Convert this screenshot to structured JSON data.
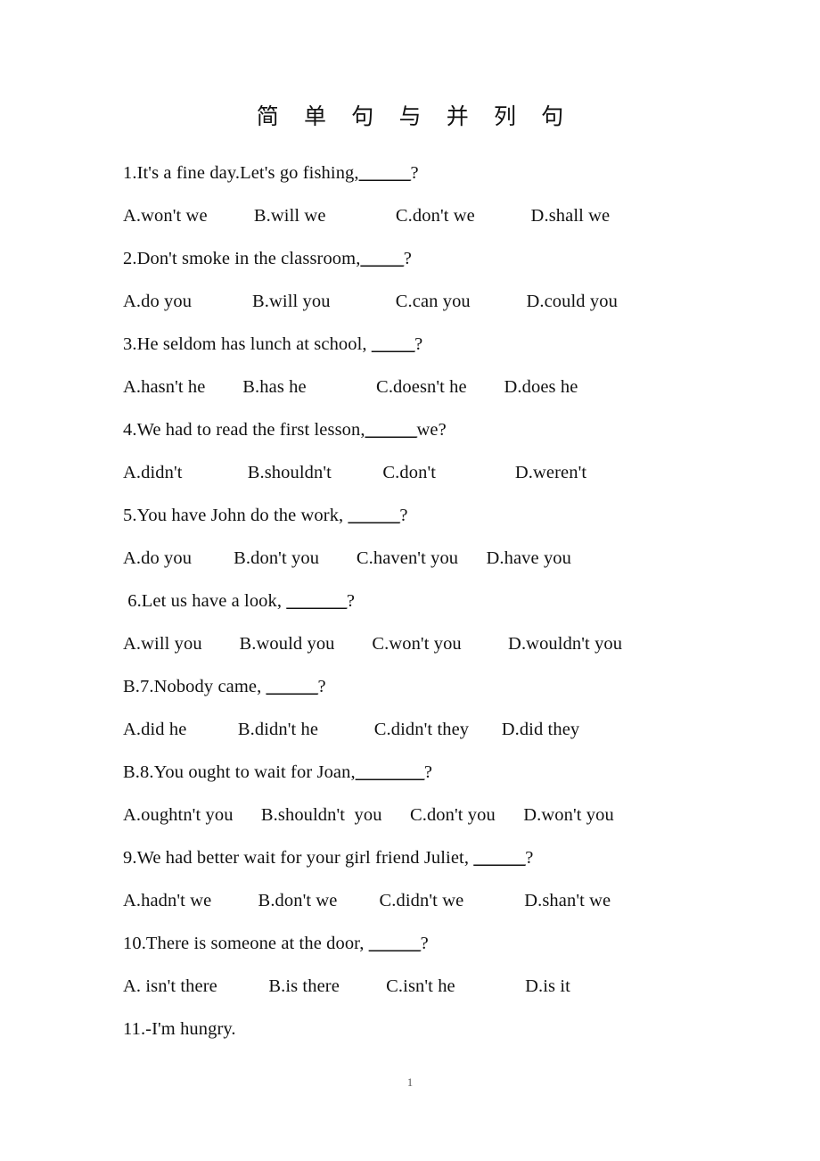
{
  "document": {
    "title": "简 单 句 与 并 列 句",
    "page_number": "1"
  },
  "items": [
    {
      "kind": "question",
      "text": "1.It's a fine day.Let's go fishing,",
      "blank": "______",
      "tail": "?"
    },
    {
      "kind": "options",
      "text": "A.won't we          B.will we               C.don't we            D.shall we"
    },
    {
      "kind": "question",
      "text": "2.Don't smoke in the classroom,",
      "blank": "_____",
      "tail": "?"
    },
    {
      "kind": "options",
      "text": "A.do you             B.will you              C.can you            D.could you"
    },
    {
      "kind": "question",
      "text": "3.He seldom has lunch at school, ",
      "blank": "_____",
      "tail": "?"
    },
    {
      "kind": "options",
      "text": "A.hasn't he        B.has he               C.doesn't he        D.does he"
    },
    {
      "kind": "question",
      "text": "4.We had to read the first lesson,",
      "blank": "______",
      "tail": "we?"
    },
    {
      "kind": "options",
      "text": "A.didn't              B.shouldn't           C.don't                 D.weren't"
    },
    {
      "kind": "question",
      "text": "5.You have John do the work, ",
      "blank": "______",
      "tail": "?"
    },
    {
      "kind": "options",
      "text": "A.do you         B.don't you        C.haven't you      D.have you"
    },
    {
      "kind": "question",
      "text": " 6.Let us have a look, ",
      "blank": "_______",
      "tail": "?"
    },
    {
      "kind": "options",
      "text": "A.will you        B.would you        C.won't you          D.wouldn't you"
    },
    {
      "kind": "question",
      "text": "B.7.Nobody came, ",
      "blank": "______",
      "tail": "?"
    },
    {
      "kind": "options",
      "text": "A.did he           B.didn't he            C.didn't they       D.did they"
    },
    {
      "kind": "question",
      "text": "B.8.You ought to wait for Joan,",
      "blank": "________",
      "tail": "?"
    },
    {
      "kind": "options",
      "text": "A.oughtn't you      B.shouldn't  you      C.don't you      D.won't you"
    },
    {
      "kind": "question",
      "text": "9.We had better wait for your girl friend Juliet, ",
      "blank": "______",
      "tail": "?"
    },
    {
      "kind": "options",
      "text": "A.hadn't we          B.don't we         C.didn't we             D.shan't we"
    },
    {
      "kind": "question",
      "text": "10.There is someone at the door, ",
      "blank": "______",
      "tail": "?"
    },
    {
      "kind": "options",
      "text": "A. isn't there           B.is there          C.isn't he               D.is it"
    },
    {
      "kind": "question",
      "text": "11.-I'm hungry.",
      "blank": "",
      "tail": ""
    }
  ]
}
